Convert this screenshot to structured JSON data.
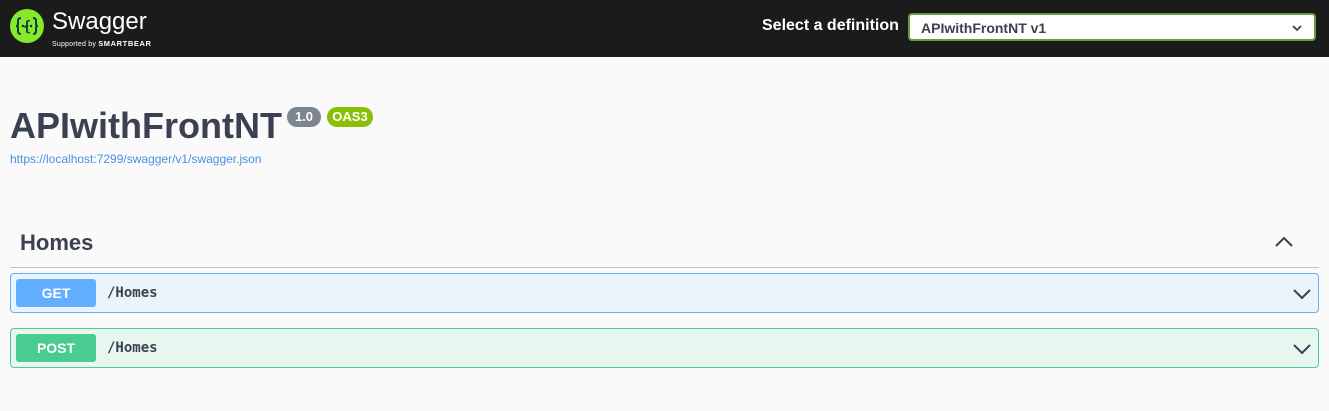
{
  "header": {
    "logo_text": "Swagger",
    "logo_sub_prefix": "Supported by",
    "logo_sub_brand": "SMARTBEAR",
    "definition_label": "Select a definition",
    "definition_selected": "APIwithFrontNT v1"
  },
  "info": {
    "title": "APIwithFrontNT",
    "version": "1.0",
    "oas_badge": "OAS3",
    "spec_url": "https://localhost:7299/swagger/v1/swagger.json"
  },
  "tags": [
    {
      "name": "Homes",
      "operations": [
        {
          "method": "GET",
          "path": "/Homes"
        },
        {
          "method": "POST",
          "path": "/Homes"
        }
      ]
    }
  ],
  "colors": {
    "topbar": "#1b1b1b",
    "logo": "#85ea2d",
    "get": "#61affe",
    "post": "#49cc90",
    "oas": "#89bf04",
    "version": "#7d8492",
    "link": "#4990e2"
  }
}
